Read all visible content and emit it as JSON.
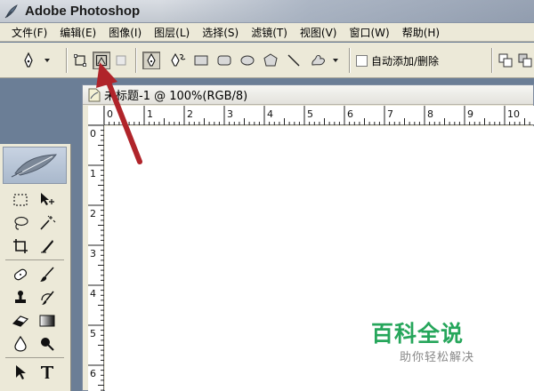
{
  "window": {
    "title": "Adobe Photoshop",
    "icon": "feather-icon"
  },
  "menu": {
    "items": [
      {
        "label": "文件(F)"
      },
      {
        "label": "编辑(E)"
      },
      {
        "label": "图像(I)"
      },
      {
        "label": "图层(L)"
      },
      {
        "label": "选择(S)"
      },
      {
        "label": "滤镜(T)"
      },
      {
        "label": "视图(V)"
      },
      {
        "label": "窗口(W)"
      },
      {
        "label": "帮助(H)"
      }
    ]
  },
  "options": {
    "auto_add_delete_label": "自动添加/删除",
    "auto_add_delete_checked": false,
    "active_mode": "paths"
  },
  "document": {
    "title": "未标题-1 @ 100%(RGB/8)",
    "ruler_top": [
      "0",
      "1",
      "2",
      "3",
      "4",
      "5",
      "6",
      "7",
      "8",
      "9",
      "10"
    ],
    "ruler_left": [
      "0",
      "1",
      "2",
      "3",
      "4",
      "5",
      "6"
    ]
  },
  "watermark": {
    "title": "百科全说",
    "subtitle": "助你轻松解决"
  },
  "colors": {
    "annotation_arrow": "#b0242a",
    "watermark_green": "#26a65b"
  }
}
